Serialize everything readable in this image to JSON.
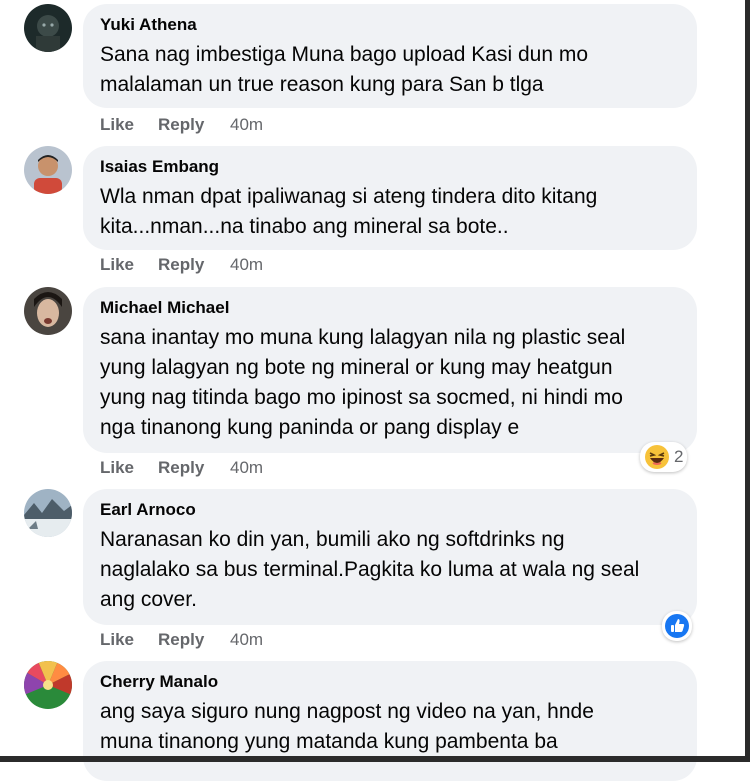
{
  "comments": [
    {
      "author": "Yuki Athena",
      "text": "Sana nag imbestiga Muna bago upload Kasi dun mo\nmalalaman un true reason kung para San b tlga",
      "like": "Like",
      "reply": "Reply",
      "time": "40m",
      "avatar_icon": "profile-photo-dark"
    },
    {
      "author": "Isaias Embang",
      "text": "Wla nman dpat ipaliwanag si ateng tindera dito kitang\nkita...nman...na tinabo ang mineral sa bote..",
      "like": "Like",
      "reply": "Reply",
      "time": "40m",
      "avatar_icon": "profile-photo-man"
    },
    {
      "author": "Michael Michael",
      "text": "sana inantay mo muna kung lalagyan nila ng plastic seal\nyung lalagyan ng bote ng mineral or kung may heatgun\nyung nag titinda bago mo ipinost sa socmed, ni hindi mo\nnga tinanong kung paninda or pang display e",
      "like": "Like",
      "reply": "Reply",
      "time": "40m",
      "avatar_icon": "profile-photo-face",
      "reaction": {
        "icon": "haha-emoji-icon",
        "count": "2"
      }
    },
    {
      "author": "Earl Arnoco",
      "text": "Naranasan ko din yan, bumili ako ng softdrinks ng\nnaglalako sa bus terminal.Pagkita ko luma at wala ng seal\nang cover.",
      "like": "Like",
      "reply": "Reply",
      "time": "40m",
      "avatar_icon": "profile-photo-landscape",
      "reaction": {
        "icon": "like-thumb-icon",
        "count": ""
      }
    },
    {
      "author": "Cherry Manalo",
      "text": "ang saya siguro nung nagpost ng video na yan, hnde\nmuna tinanong yung matanda kung pambenta ba",
      "avatar_icon": "profile-photo-colorful"
    }
  ],
  "colors": {
    "bubble": "#f0f2f5",
    "meta": "#65676b",
    "like_blue": "#1877f2",
    "haha_yellow": "#f7c23a"
  }
}
